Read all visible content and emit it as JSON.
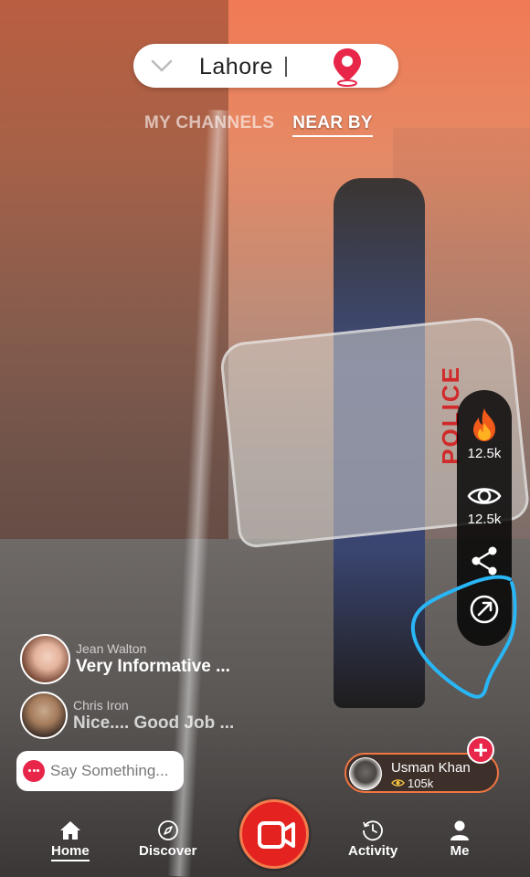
{
  "header": {
    "location": "Lahore",
    "icons": {
      "dropdown": "chevron-down-icon",
      "pin": "location-pin-icon"
    }
  },
  "channel_tabs": [
    {
      "label": "MY CHANNELS",
      "active": false
    },
    {
      "label": "NEAR BY",
      "active": true
    }
  ],
  "side_actions": {
    "likes": {
      "icon": "fire-icon",
      "count": "12.5k"
    },
    "views": {
      "icon": "eye-icon",
      "count": "12.5k"
    },
    "share": {
      "icon": "share-icon"
    },
    "open": {
      "icon": "open-external-icon"
    }
  },
  "comments": [
    {
      "name": "Jean Walton",
      "message": "Very Informative ..."
    },
    {
      "name": "Chris Iron",
      "message": "Nice.... Good Job ..."
    }
  ],
  "comment_input": {
    "placeholder": "Say Something..."
  },
  "host": {
    "name": "Usman Khan",
    "views": "105k"
  },
  "bottom_nav": {
    "home": "Home",
    "discover": "Discover",
    "activity": "Activity",
    "me": "Me"
  },
  "colors": {
    "accent": "#e8264a",
    "record": "#e42220",
    "host_border": "#f07642",
    "annotation": "#29b6f6"
  }
}
